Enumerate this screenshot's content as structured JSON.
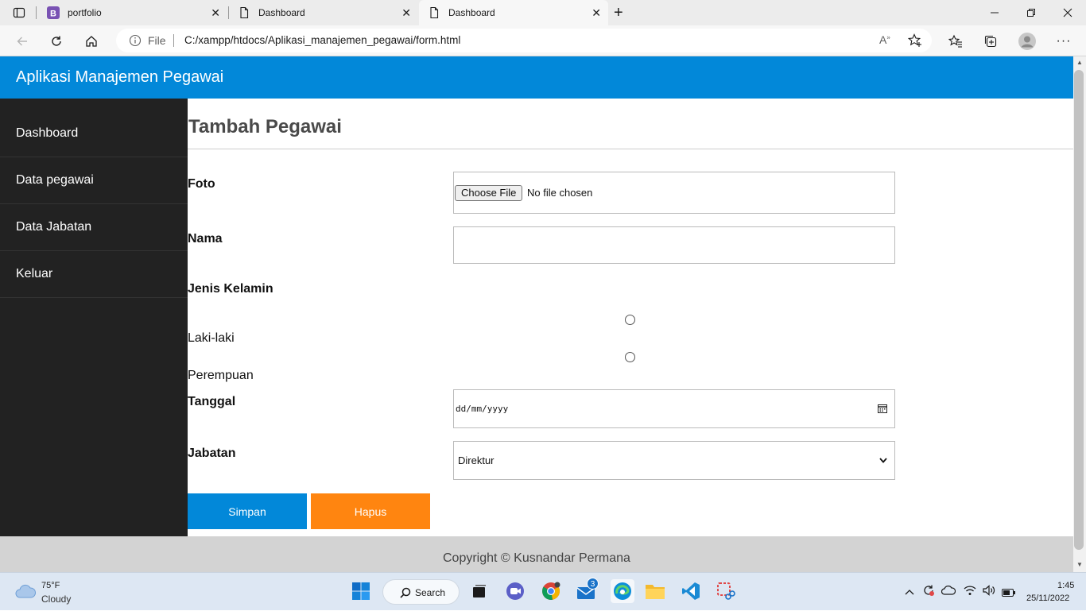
{
  "browser": {
    "tabs": [
      {
        "title": "portfolio",
        "icon": "bootstrap-icon"
      },
      {
        "title": "Dashboard",
        "icon": "page-icon"
      },
      {
        "title": "Dashboard",
        "icon": "page-icon",
        "active": true
      }
    ],
    "address": {
      "scheme_label": "File",
      "url": "C:/xampp/htdocs/Aplikasi_manajemen_pegawai/form.html"
    }
  },
  "app": {
    "title": "Aplikasi Manajemen Pegawai",
    "header_color": "#0288d9",
    "sidebar": {
      "items": [
        {
          "label": "Dashboard"
        },
        {
          "label": "Data pegawai"
        },
        {
          "label": "Data Jabatan"
        },
        {
          "label": "Keluar"
        }
      ]
    },
    "page_title": "Tambah Pegawai",
    "form": {
      "foto_label": "Foto",
      "choose_file_label": "Choose File",
      "no_file_text": "No file chosen",
      "nama_label": "Nama",
      "nama_value": "",
      "jenis_kelamin_label": "Jenis Kelamin",
      "gender_options": [
        {
          "label": "Laki-laki",
          "checked": false
        },
        {
          "label": "Perempuan",
          "checked": false
        }
      ],
      "tanggal_label": "Tanggal",
      "tanggal_placeholder": "dd/mm/yyyy",
      "jabatan_label": "Jabatan",
      "jabatan_selected": "Direktur"
    },
    "buttons": {
      "simpan": "Simpan",
      "hapus": "Hapus",
      "simpan_color": "#0288d9",
      "hapus_color": "#ff8510"
    },
    "footer": "Copyright © Kusnandar Permana"
  },
  "taskbar": {
    "weather_temp": "75°F",
    "weather_desc": "Cloudy",
    "search_label": "Search",
    "mail_badge": "3",
    "time": "1:45",
    "date": "25/11/2022"
  }
}
